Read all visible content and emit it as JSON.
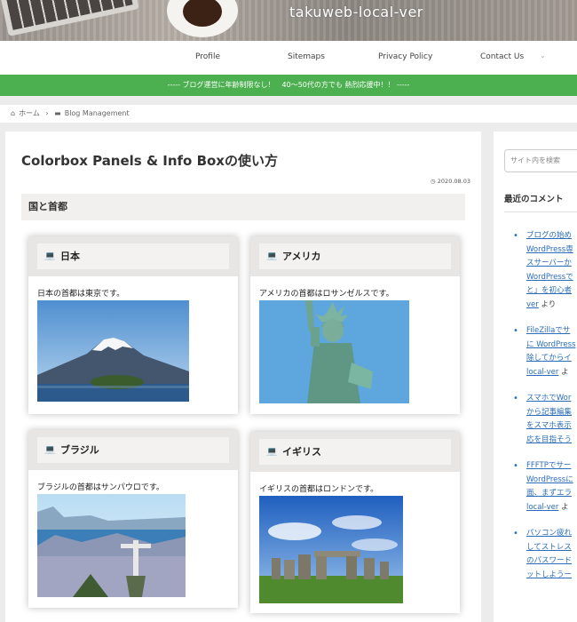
{
  "site": {
    "title": "takuweb-local-ver"
  },
  "nav": {
    "items": [
      "Profile",
      "Sitemaps",
      "Privacy Policy",
      "Contact Us"
    ]
  },
  "notice": "----- ブログ運営に年齢制限なし！　40～50代の方でも 熱烈応援中！！ -----",
  "breadcrumb": {
    "home": "ホーム",
    "sep": "›",
    "category": "Blog Management"
  },
  "article": {
    "title": "Colorbox Panels & Info Boxの使い方",
    "date": "2020.08.03",
    "heading": "国と首都"
  },
  "panels": [
    {
      "title": "日本",
      "text": "日本の首都は東京です。"
    },
    {
      "title": "アメリカ",
      "text": "アメリカの首都はロサンゼルスです。"
    },
    {
      "title": "ブラジル",
      "text": "ブラジルの首都はサンパウロです。"
    },
    {
      "title": "イギリス",
      "text": "イギリスの首都はロンドンです。"
    }
  ],
  "sidebar": {
    "search_placeholder": "サイト内を検索",
    "recent_heading": "最近のコメント",
    "comments": [
      {
        "l1": "ブログの始め",
        "l2": "WordPress専",
        "l3": "スサーバーか",
        "l4": "WordPressで",
        "l5": "と」を初心者",
        "l6": "ver",
        "suffix": " より"
      },
      {
        "l1": "FileZillaでサ",
        "l2": "に WordPress",
        "l3": "除してからイ",
        "l4": "local-ver",
        "suffix": " よ"
      },
      {
        "l1": "スマホでWor",
        "l2": "から記事編集",
        "l3": "をスマホ表示",
        "l4": "応を目指そう"
      },
      {
        "l1": "FFFTPでサー",
        "l2": "WordPressに",
        "l3": "面、まずエラ",
        "l4": "local-ver",
        "suffix": " よ"
      },
      {
        "l1": "パソコン疲れ",
        "l2": "してストレス",
        "l3": "のパスワード",
        "l4": "ットしようー"
      }
    ]
  },
  "colors": {
    "accent_green": "#4caf50",
    "link_blue": "#2a6ebb"
  }
}
